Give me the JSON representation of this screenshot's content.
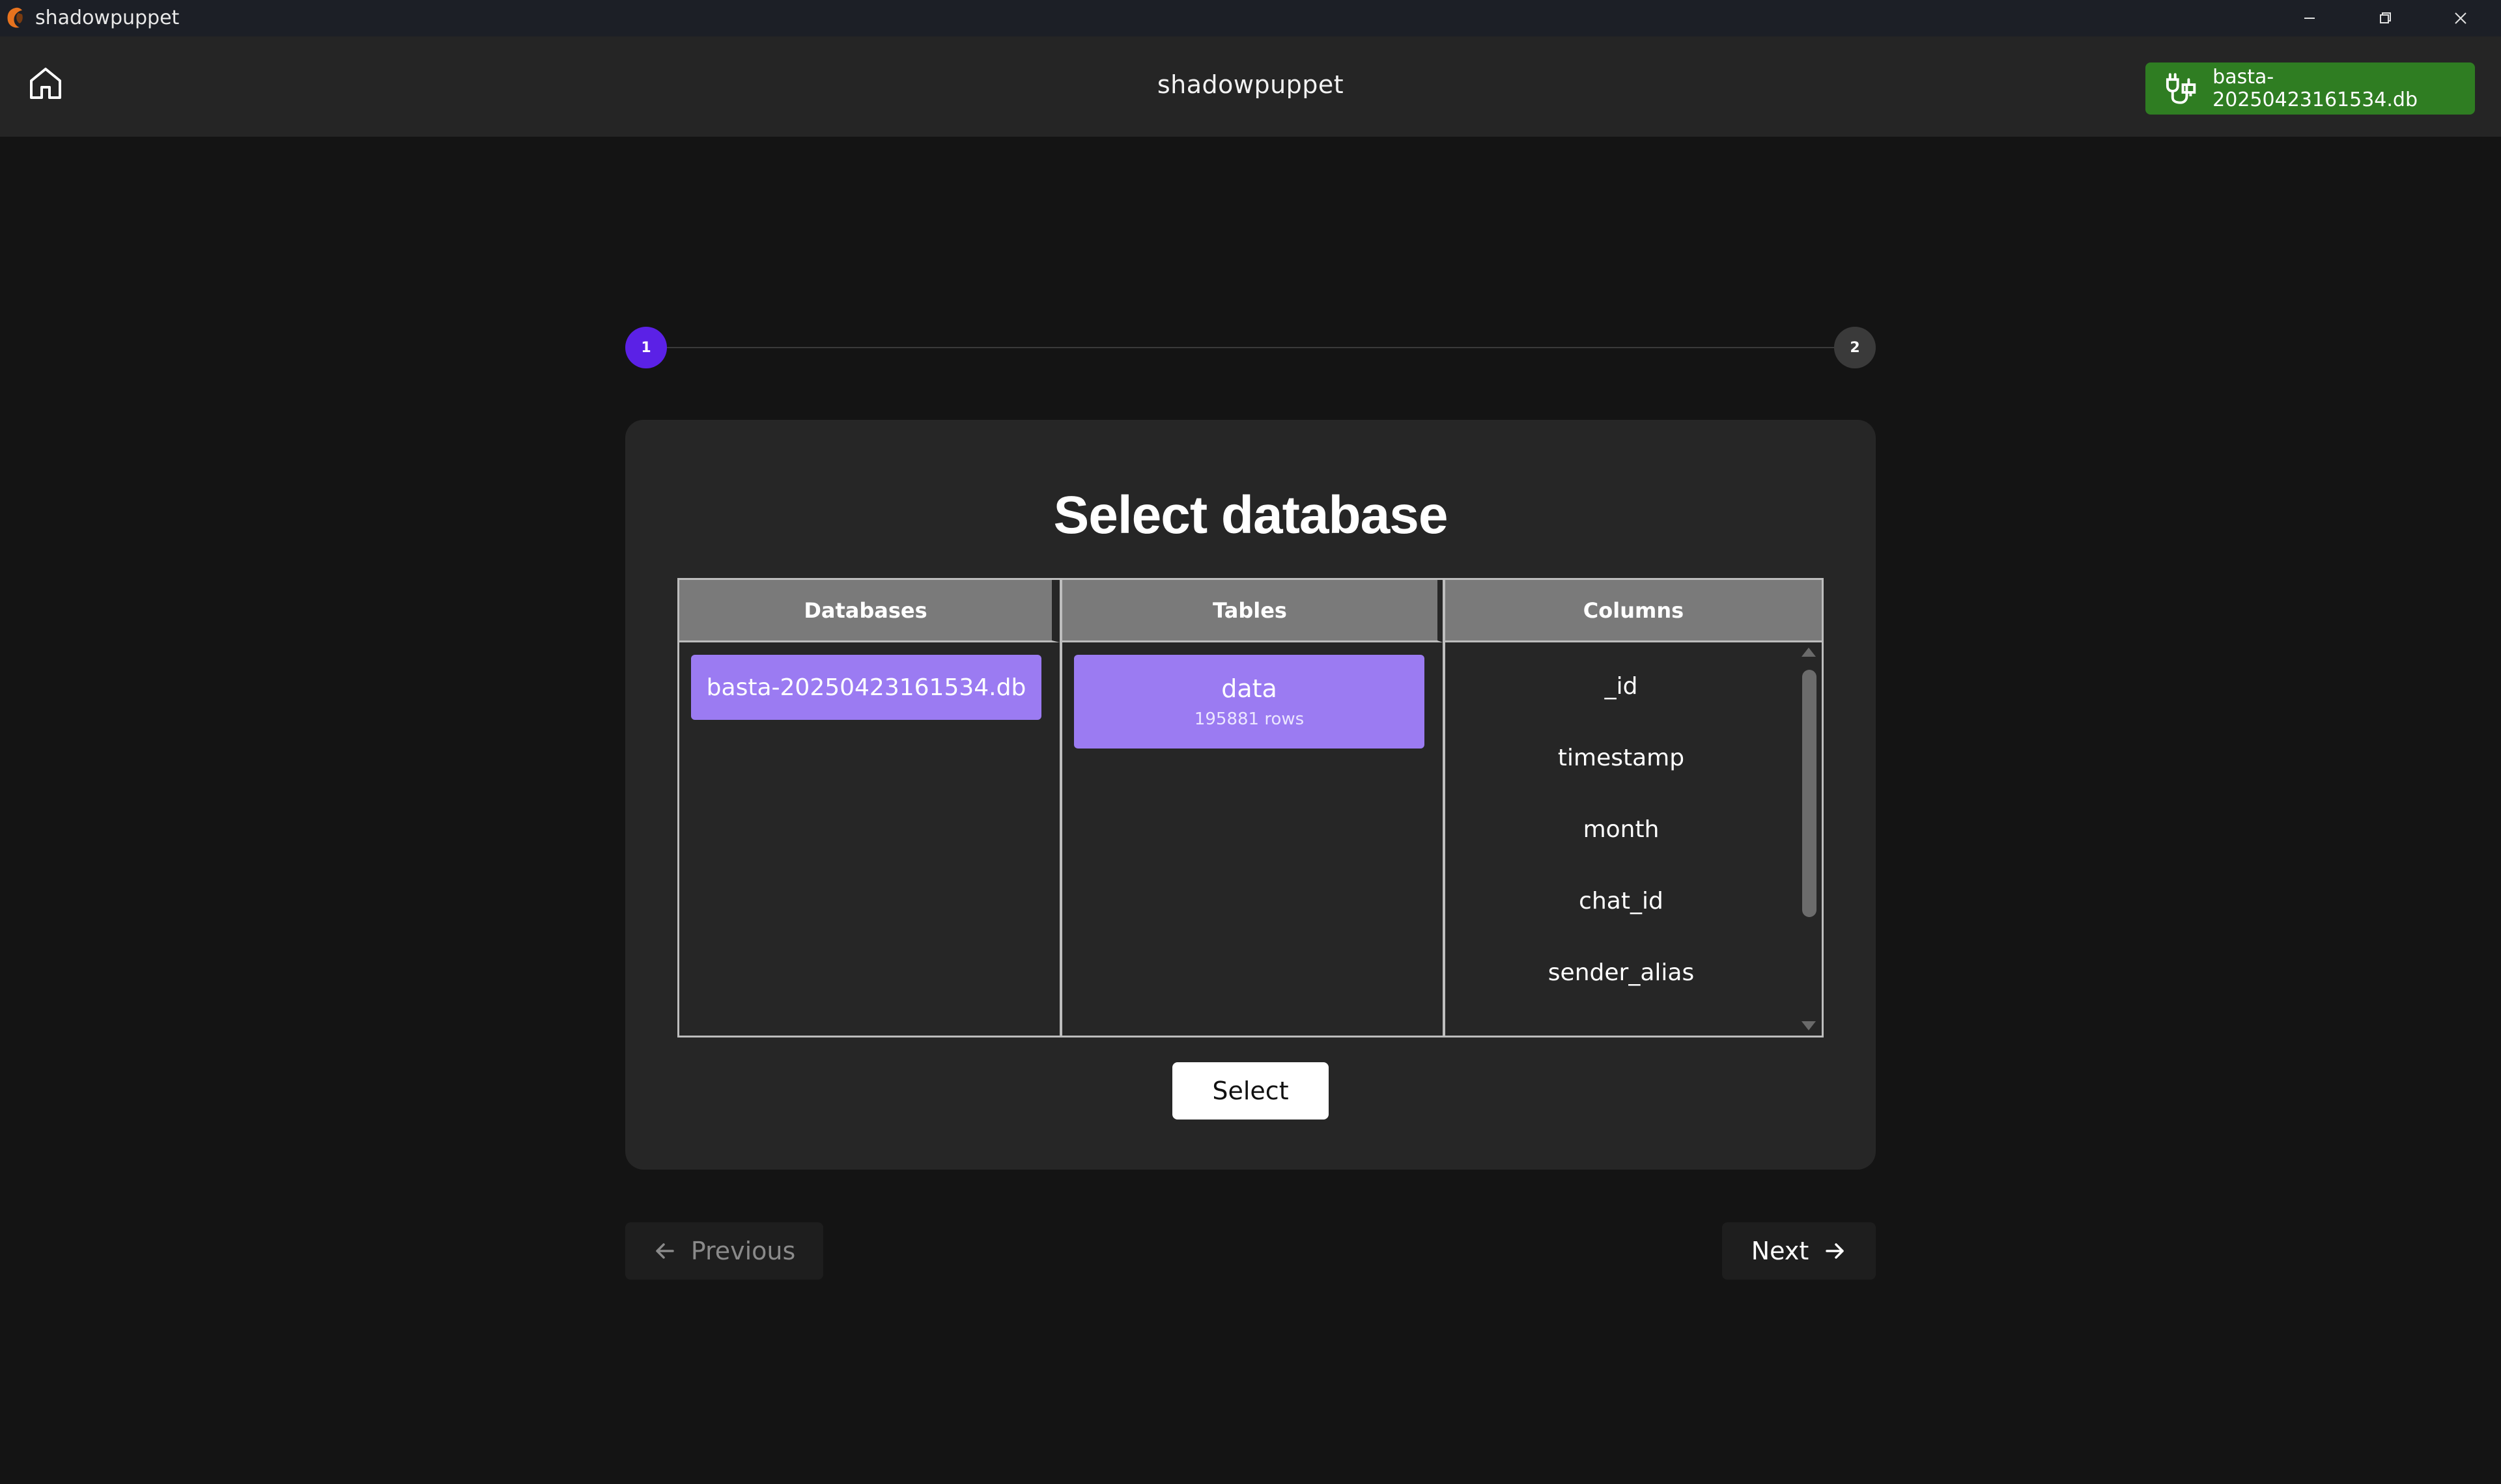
{
  "window": {
    "app_name": "shadowpuppet",
    "controls": [
      "minimize-icon",
      "restore-icon",
      "close-icon"
    ]
  },
  "header": {
    "title": "shadowpuppet",
    "home_icon": "home-icon",
    "connection_badge": {
      "icon": "plug-connected-icon",
      "label": "basta-20250423161534.db",
      "color": "#2f7d22"
    }
  },
  "stepper": {
    "steps": [
      {
        "number": "1",
        "active": true
      },
      {
        "number": "2",
        "active": false
      }
    ],
    "active_color": "#5b21e6"
  },
  "card": {
    "title": "Select database",
    "columns": {
      "databases": {
        "header": "Databases",
        "items": [
          "basta-20250423161534.db"
        ],
        "selected": "basta-20250423161534.db"
      },
      "tables": {
        "header": "Tables",
        "items": [
          {
            "name": "data",
            "rows": "195881 rows"
          }
        ],
        "selected": "data"
      },
      "columns": {
        "header": "Columns",
        "items": [
          "_id",
          "timestamp",
          "month",
          "chat_id",
          "sender_alias"
        ]
      }
    },
    "select_button": "Select",
    "selection_color": "#9b7bf2"
  },
  "navigation": {
    "previous_label": "Previous",
    "next_label": "Next"
  }
}
